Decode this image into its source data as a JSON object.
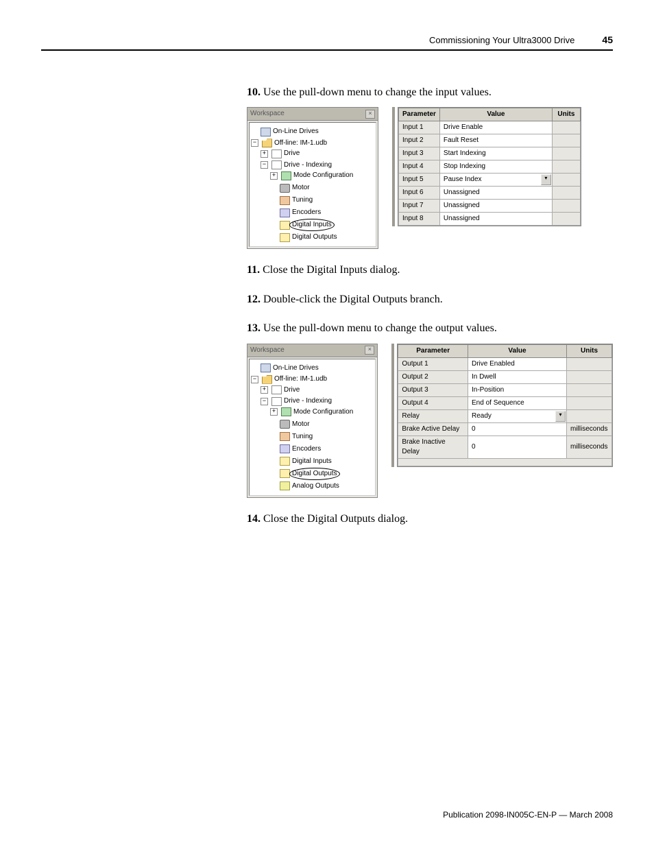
{
  "header": {
    "title": "Commissioning Your Ultra3000 Drive",
    "page": "45"
  },
  "steps": {
    "s10": {
      "num": "10.",
      "text": "Use the pull-down menu to change the input values."
    },
    "s11": {
      "num": "11.",
      "text": "Close the Digital Inputs dialog."
    },
    "s12": {
      "num": "12.",
      "text": "Double-click the Digital Outputs branch."
    },
    "s13": {
      "num": "13.",
      "text": "Use the pull-down menu to change the output values."
    },
    "s14": {
      "num": "14.",
      "text": "Close the Digital Outputs dialog."
    }
  },
  "workspace_label": "Workspace",
  "tree1": {
    "n0": "On-Line Drives",
    "n1": "Off-line: IM-1.udb",
    "n2": "Drive",
    "n3": "Drive - Indexing",
    "n4": "Mode Configuration",
    "n5": "Motor",
    "n6": "Tuning",
    "n7": "Encoders",
    "n8": "Digital Inputs",
    "n9": "Digital Outputs"
  },
  "tree2": {
    "n0": "On-Line Drives",
    "n1": "Off-line: IM-1.udb",
    "n2": "Drive",
    "n3": "Drive - Indexing",
    "n4": "Mode Configuration",
    "n5": "Motor",
    "n6": "Tuning",
    "n7": "Encoders",
    "n8": "Digital Inputs",
    "n9": "Digital Outputs",
    "n10": "Analog Outputs"
  },
  "table_headers": {
    "parameter": "Parameter",
    "value": "Value",
    "units": "Units"
  },
  "table1": {
    "r0": {
      "p": "Input 1",
      "v": "Drive Enable",
      "u": ""
    },
    "r1": {
      "p": "Input 2",
      "v": "Fault Reset",
      "u": ""
    },
    "r2": {
      "p": "Input 3",
      "v": "Start Indexing",
      "u": ""
    },
    "r3": {
      "p": "Input 4",
      "v": "Stop Indexing",
      "u": ""
    },
    "r4": {
      "p": "Input 5",
      "v": "Pause Index",
      "u": ""
    },
    "r5": {
      "p": "Input 6",
      "v": "Unassigned",
      "u": ""
    },
    "r6": {
      "p": "Input 7",
      "v": "Unassigned",
      "u": ""
    },
    "r7": {
      "p": "Input 8",
      "v": "Unassigned",
      "u": ""
    }
  },
  "table2": {
    "r0": {
      "p": "Output 1",
      "v": "Drive Enabled",
      "u": ""
    },
    "r1": {
      "p": "Output 2",
      "v": "In Dwell",
      "u": ""
    },
    "r2": {
      "p": "Output 3",
      "v": "In-Position",
      "u": ""
    },
    "r3": {
      "p": "Output 4",
      "v": "End of Sequence",
      "u": ""
    },
    "r4": {
      "p": "Relay",
      "v": "Ready",
      "u": ""
    },
    "r5": {
      "p": "Brake Active Delay",
      "v": "0",
      "u": "milliseconds"
    },
    "r6": {
      "p": "Brake Inactive Delay",
      "v": "0",
      "u": "milliseconds"
    }
  },
  "footer": "Publication 2098-IN005C-EN-P — March 2008"
}
